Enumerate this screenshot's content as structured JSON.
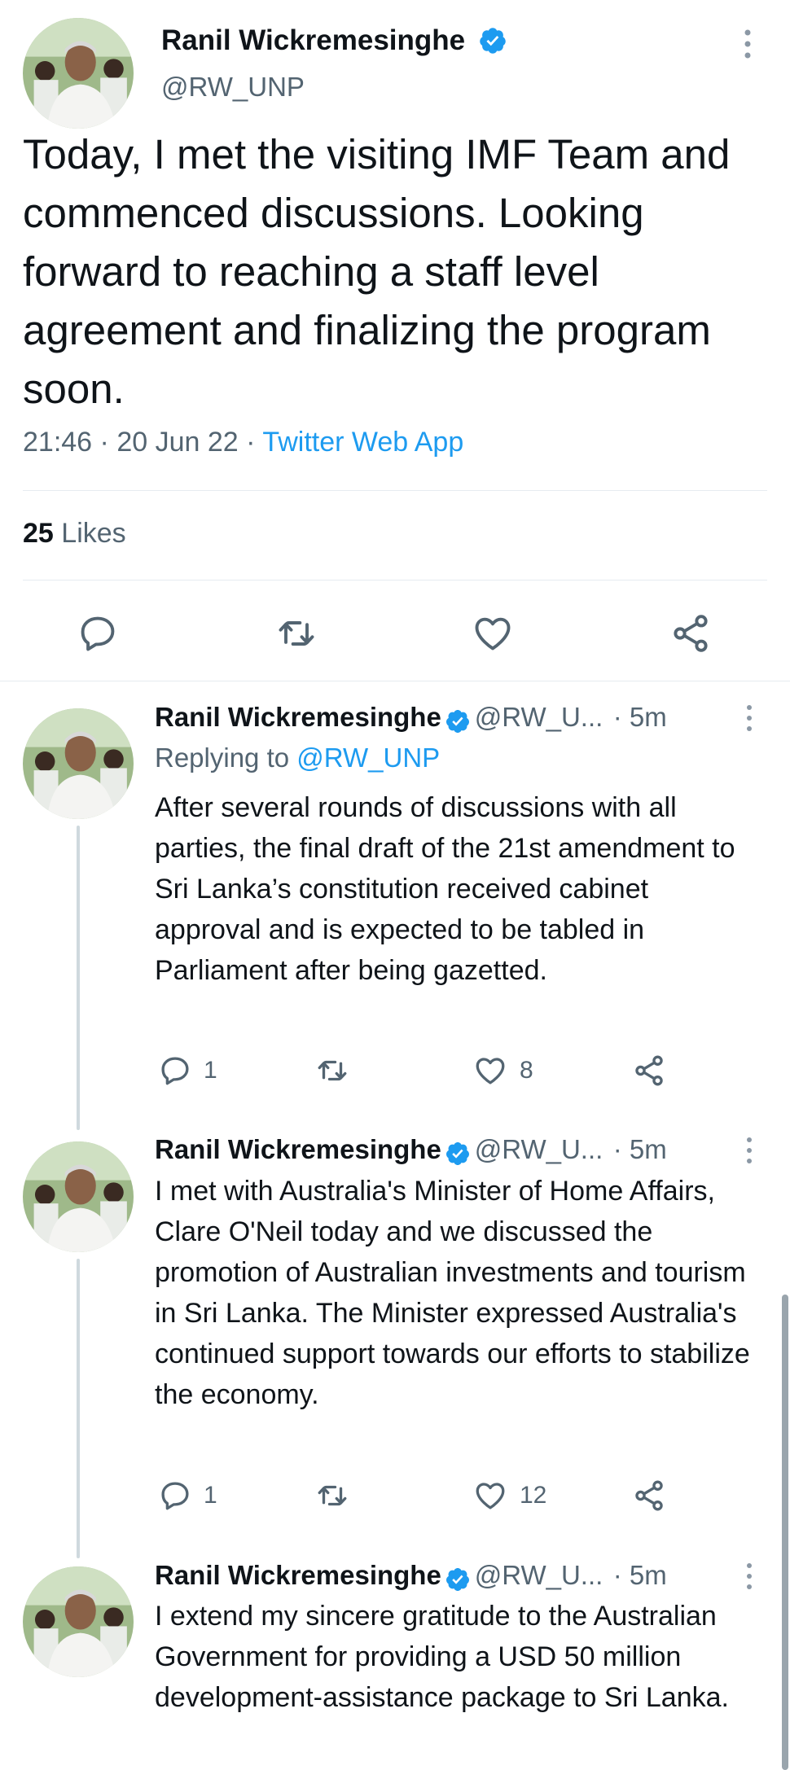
{
  "main_tweet": {
    "author_name": "Ranil Wickremesinghe",
    "author_handle": "@RW_UNP",
    "text": "Today, I met the visiting IMF Team and commenced discussions. Looking forward to reaching a staff level agreement and finalizing the program soon.",
    "time": "21:46",
    "date": "20 Jun 22",
    "source": "Twitter Web App",
    "separator": "·",
    "likes_count": "25",
    "likes_label": "Likes"
  },
  "replies": [
    {
      "author_name": "Ranil Wickremesinghe",
      "author_handle": "@RW_U...",
      "age": "· 5m",
      "replying_prefix": "Replying to ",
      "replying_handle": "@RW_UNP",
      "text": "After several rounds of discussions with all parties, the final draft of the 21st amendment to Sri Lanka’s constitution received cabinet approval and is expected to be tabled in Parliament after being gazetted.",
      "reply_count": "1",
      "like_count": "8"
    },
    {
      "author_name": "Ranil Wickremesinghe",
      "author_handle": "@RW_U...",
      "age": "· 5m",
      "text": "I met with Australia's Minister of Home Affairs, Clare O'Neil today and we discussed the promotion of Australian investments and tourism in Sri Lanka. The Minister expressed Australia's continued support towards our efforts to stabilize the economy.",
      "reply_count": "1",
      "like_count": "12"
    },
    {
      "author_name": "Ranil Wickremesinghe",
      "author_handle": "@RW_U...",
      "age": "· 5m",
      "text": "I extend my sincere gratitude to the Australian Government for providing a USD 50 million development-assistance package to Sri Lanka."
    }
  ],
  "icons": {
    "verified": "verified-badge-icon",
    "more": "more-vertical-icon",
    "reply": "reply-bubble-icon",
    "retweet": "retweet-icon",
    "like": "heart-icon",
    "share": "share-icon"
  },
  "colors": {
    "text": "#0f1419",
    "muted": "#536471",
    "link": "#1d9bf0",
    "verified": "#1d9bf0",
    "divider": "#e6ecf0",
    "thread_line": "#cfd9de"
  }
}
